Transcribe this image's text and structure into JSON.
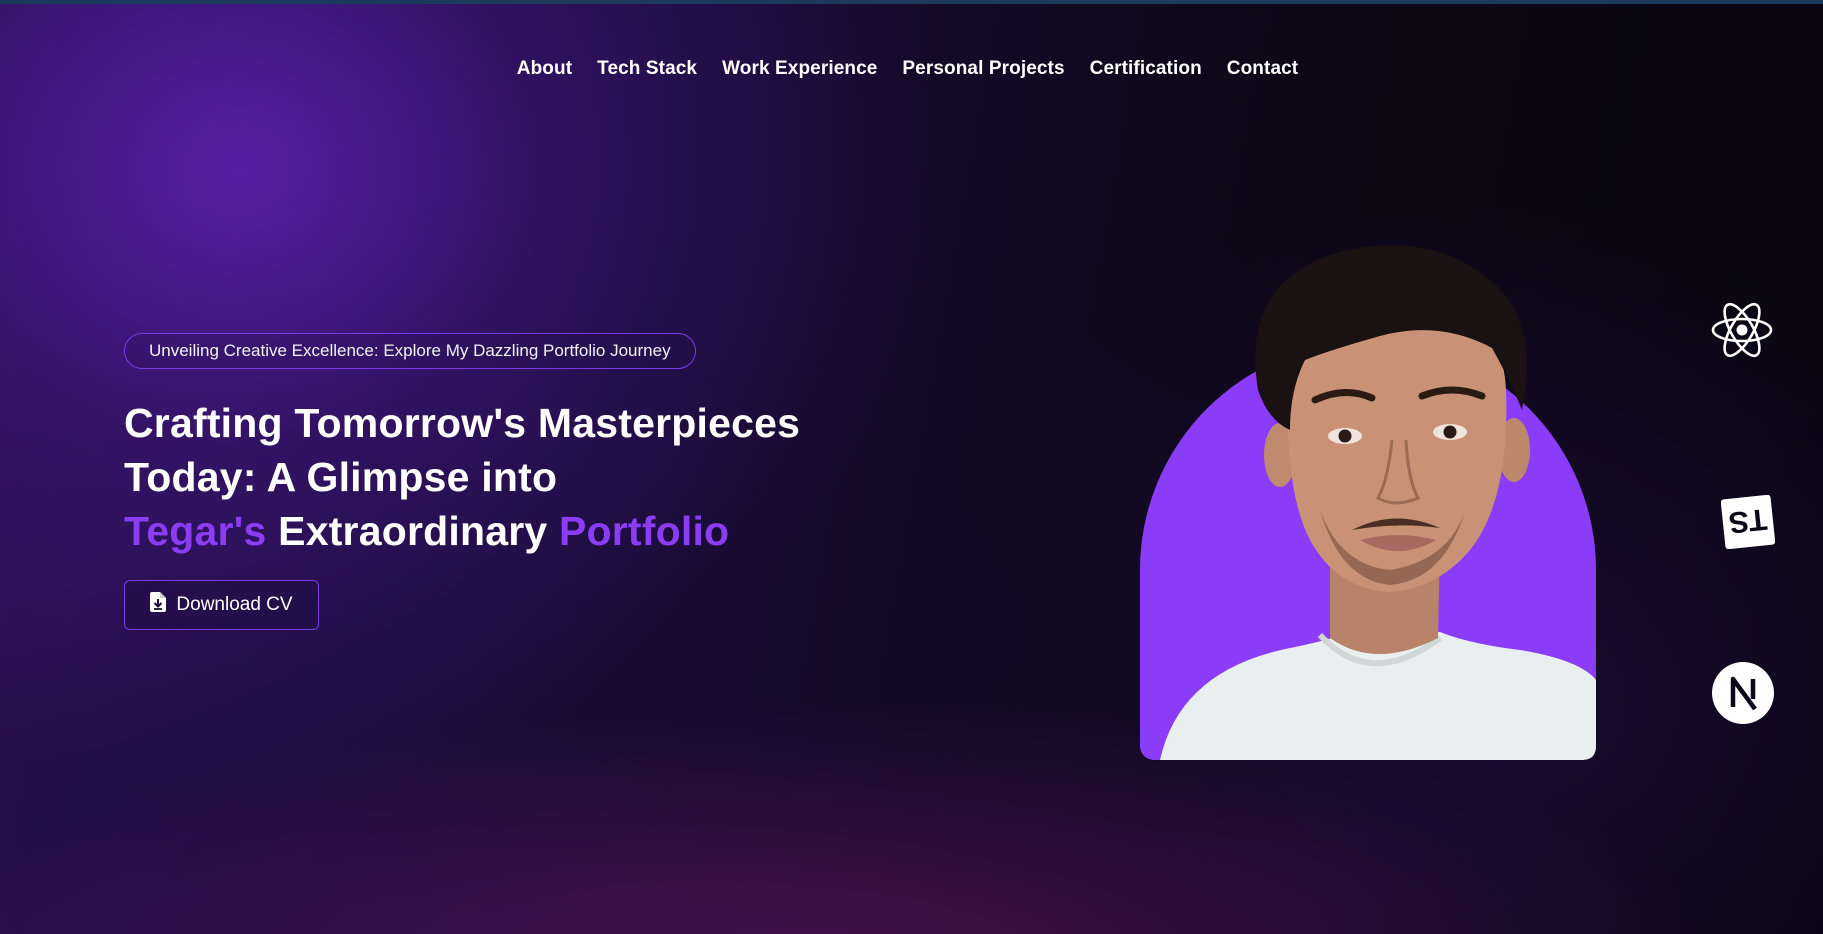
{
  "nav": {
    "items": [
      {
        "label": "About"
      },
      {
        "label": "Tech Stack"
      },
      {
        "label": "Work Experience"
      },
      {
        "label": "Personal Projects"
      },
      {
        "label": "Certification"
      },
      {
        "label": "Contact"
      }
    ]
  },
  "hero": {
    "tagline": "Unveiling Creative Excellence: Explore My Dazzling Portfolio Journey",
    "headline": {
      "line1": "Crafting Tomorrow's Masterpieces",
      "line2": "Today: A Glimpse into",
      "line3_accent1": "Tegar's",
      "line3_mid": " Extraordinary ",
      "line3_accent2": "Portfolio"
    },
    "download_label": "Download CV",
    "download_icon": "file-download-icon"
  },
  "tech_icons": {
    "ts_text": "TS"
  },
  "colors": {
    "accent": "#8b3cf5",
    "arch": "#8b3cf8",
    "border": "#7c3aed",
    "background_dark": "#0d0818"
  }
}
